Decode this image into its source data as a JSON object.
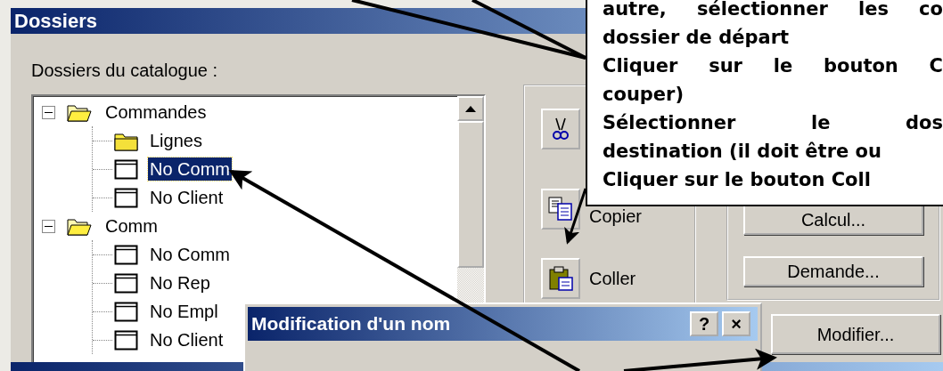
{
  "window": {
    "title": "Dossiers"
  },
  "tree": {
    "label": "Dossiers du catalogue :",
    "items": [
      {
        "label": "Commandes",
        "kind": "folder",
        "expanded": true,
        "selected": false,
        "children": [
          {
            "label": "Lignes",
            "kind": "folder",
            "selected": false
          },
          {
            "label": "No Comm",
            "kind": "field",
            "selected": true
          },
          {
            "label": "No Client",
            "kind": "field",
            "selected": false
          }
        ]
      },
      {
        "label": "Comm",
        "kind": "folder",
        "expanded": true,
        "selected": false,
        "children": [
          {
            "label": "No Comm",
            "kind": "field",
            "selected": false
          },
          {
            "label": "No Rep",
            "kind": "field",
            "selected": false
          },
          {
            "label": "No Empl",
            "kind": "field",
            "selected": false
          },
          {
            "label": "No Client",
            "kind": "field",
            "selected": false
          }
        ]
      }
    ]
  },
  "edit_buttons": [
    {
      "kind": "cut"
    },
    {
      "kind": "copy",
      "label": "Copier"
    },
    {
      "kind": "paste",
      "label": "Coller"
    }
  ],
  "group_buttons": [
    "Calcul...",
    "Demande..."
  ],
  "modify_button": "Modifier...",
  "rename_dialog": {
    "title": "Modification d'un nom",
    "buttons": [
      "?",
      "×"
    ]
  },
  "callout": {
    "lines": [
      "autre, sélectionner les co",
      "dossier de départ",
      "Cliquer sur le bouton C",
      "couper)",
      "Sélectionner le dos",
      "destination (il doit être ou",
      "Cliquer sur le bouton Coll"
    ]
  }
}
